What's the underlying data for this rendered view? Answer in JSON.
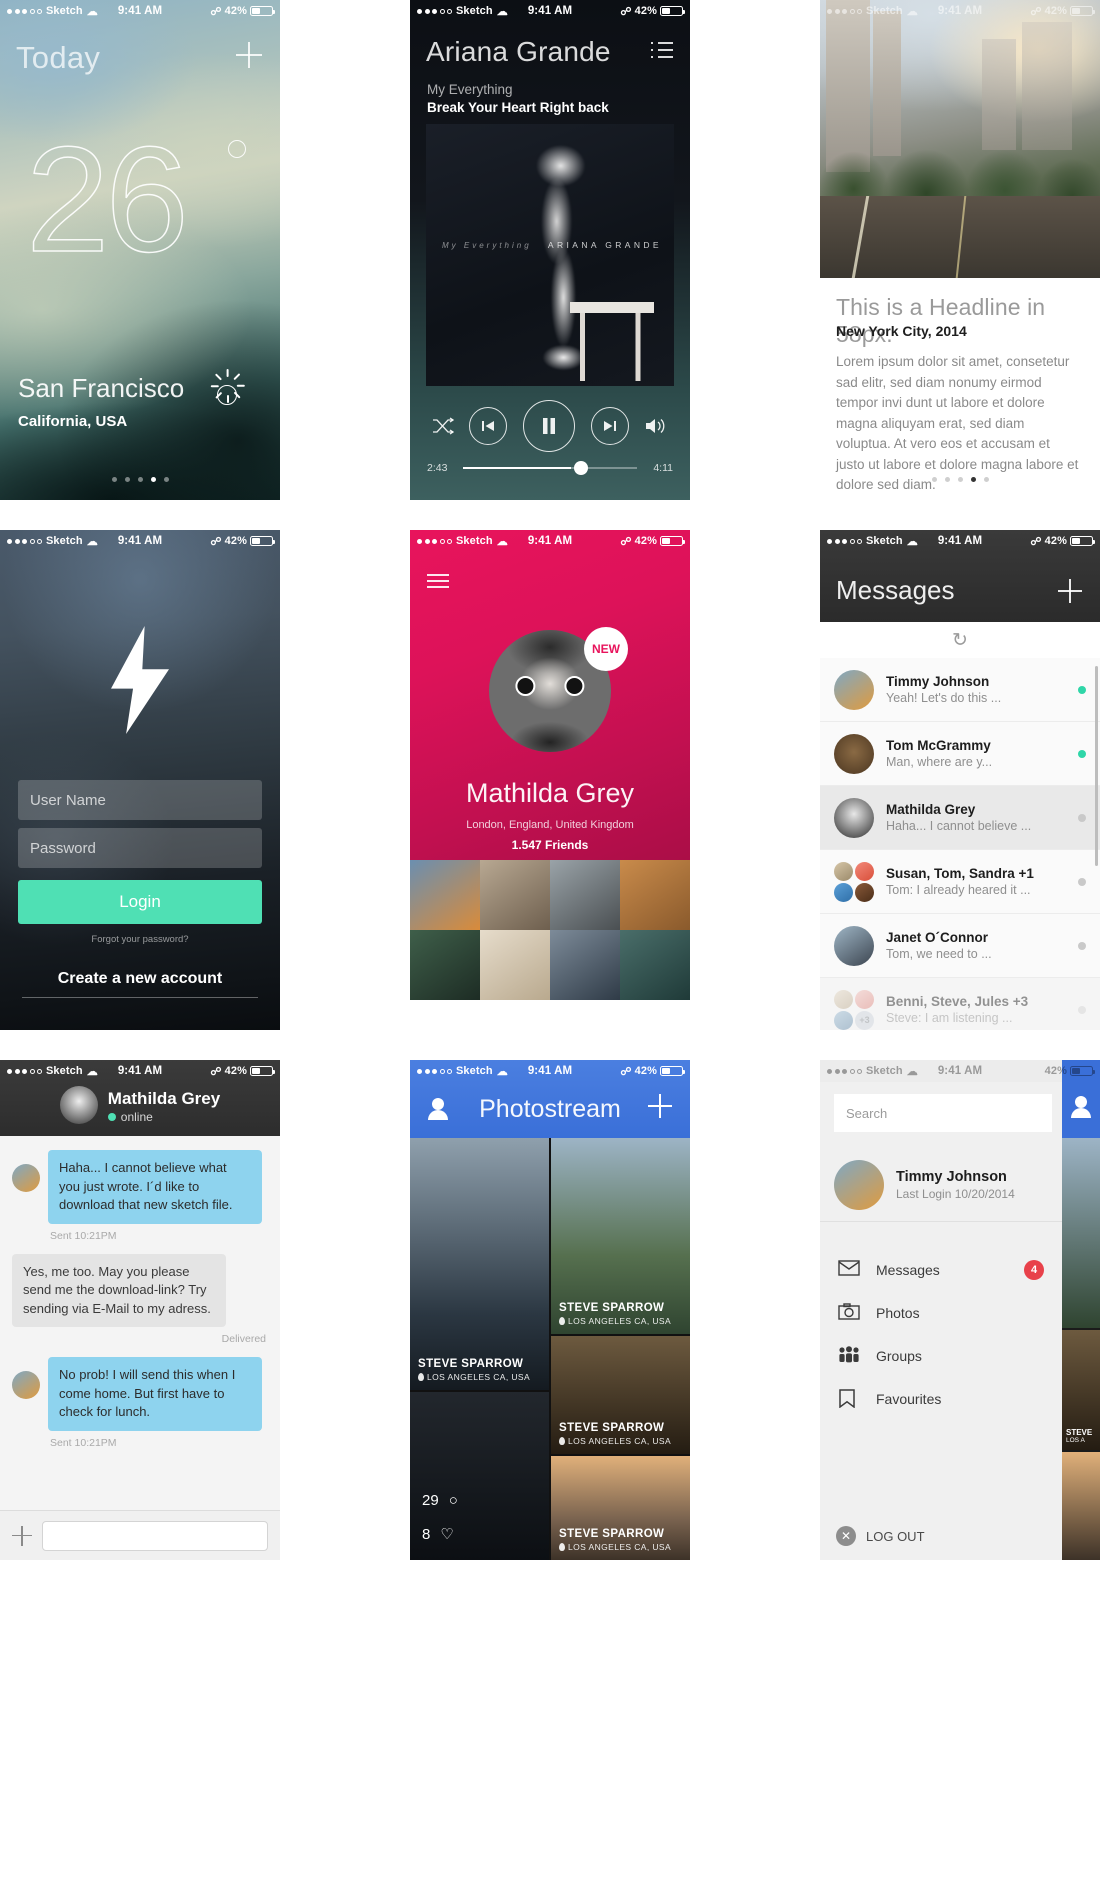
{
  "statusbar": {
    "carrier": "Sketch",
    "time": "9:41 AM",
    "battery": "42%"
  },
  "weather": {
    "title": "Today",
    "temperature": "26",
    "city": "San Francisco",
    "region": "California, USA",
    "add_label": "+",
    "pager": {
      "count": 5,
      "active": 3
    }
  },
  "music": {
    "artist": "Ariana Grande",
    "album": "My Everything",
    "track": "Break Your Heart Right back",
    "cover_left_text": "My Everything",
    "cover_right_text": "ARIANA GRANDE",
    "elapsed": "2:43",
    "remaining": "4:11",
    "progress_percent": 62,
    "controls": [
      "shuffle",
      "previous",
      "pause",
      "next",
      "volume"
    ]
  },
  "article": {
    "headline": "This is a Headline in 58px.",
    "subhead": "New York City, 2014",
    "body": "Lorem ipsum dolor sit amet, consetetur sad elitr, sed diam nonumy eirmod tempor invi dunt ut labore et dolore magna aliquyam erat, sed diam voluptua. At vero eos et accusam et justo ut labore et dolore magna labore et dolore sed diam.",
    "pager": {
      "count": 5,
      "active": 3
    }
  },
  "login": {
    "username_placeholder": "User Name",
    "password_placeholder": "Password",
    "login_label": "Login",
    "forgot_label": "Forgot your password?",
    "create_label": "Create a new account",
    "accent": "#4fe0b4"
  },
  "profile": {
    "name": "Mathilda Grey",
    "location": "London, England, United Kingdom",
    "friends": "1.547 Friends",
    "badge": "NEW",
    "brand": "#e8145c",
    "tiles": [
      {
        "name": "sneakers-photo",
        "c1": "#6b8fb0",
        "c2": "#d98b3a"
      },
      {
        "name": "desert-photo",
        "c1": "#b8a892",
        "c2": "#6e5f4e"
      },
      {
        "name": "road-photo",
        "c1": "#9aa3a8",
        "c2": "#4a4f52"
      },
      {
        "name": "food-bowl-photo",
        "c1": "#c98b4b",
        "c2": "#8a5a2c"
      },
      {
        "name": "leaves-photo",
        "c1": "#3f5f4a",
        "c2": "#1d2c24"
      },
      {
        "name": "jar-flowers-photo",
        "c1": "#e6dccb",
        "c2": "#b9a98e"
      },
      {
        "name": "skyscraper-photo",
        "c1": "#7d8b99",
        "c2": "#2f3b47"
      },
      {
        "name": "coast-photo",
        "c1": "#4a6e6a",
        "c2": "#1f3a38"
      }
    ]
  },
  "messages": {
    "title": "Messages",
    "add_label": "+",
    "refresh_icon": "refresh-icon",
    "rows": [
      {
        "name": "Timmy Johnson",
        "preview": "Yeah! Let's do this ...",
        "unread": true,
        "selected": false,
        "faded": false,
        "avatar": "sneakers-avatar"
      },
      {
        "name": "Tom McGrammy",
        "preview": "Man, where are y...",
        "unread": true,
        "selected": false,
        "faded": false,
        "avatar": "bear-avatar"
      },
      {
        "name": "Mathilda Grey",
        "preview": "Haha... I cannot believe ...",
        "unread": false,
        "selected": true,
        "faded": false,
        "avatar": "mathilda-avatar"
      },
      {
        "name": "Susan, Tom, Sandra +1",
        "preview": "Tom: I already heared it ...",
        "unread": false,
        "selected": false,
        "faded": false,
        "avatar": "group-avatar"
      },
      {
        "name": "Janet O´Connor",
        "preview": "Tom, we need to ...",
        "unread": false,
        "selected": false,
        "faded": false,
        "avatar": "boots-avatar"
      },
      {
        "name": "Benni, Steve, Jules +3",
        "preview": "Steve: I am listening ...",
        "unread": false,
        "selected": false,
        "faded": true,
        "avatar": "group-avatar-plus3"
      }
    ],
    "group_extra": "+3"
  },
  "chat": {
    "contact": "Mathilda Grey",
    "status": "online",
    "bubbles": [
      {
        "side": "in",
        "text": "Haha... I cannot believe what you just wrote. I´d like to download that new sketch file.",
        "meta": "Sent 10:21PM",
        "avatar": "sneakers-avatar"
      },
      {
        "side": "out",
        "text": "Yes, me too. May you please send me the download-link? Try sending via E-Mail to my adress.",
        "meta": "Delivered",
        "avatar": ""
      },
      {
        "side": "in",
        "text": "No prob! I will send this when I come home. But first have to check for lunch.",
        "meta": "Sent 10:21PM",
        "avatar": "sneakers-avatar"
      }
    ],
    "input_placeholder": ""
  },
  "photostream": {
    "title": "Photostream",
    "add_label": "+",
    "photos": [
      {
        "name": "stairs-photo",
        "author": "STEVE SPARROW",
        "place": "LOS ANGELES CA, USA",
        "c1": "#5b6d7a",
        "c2": "#1b2630"
      },
      {
        "name": "counter-stats-photo",
        "likes": "8",
        "comments": "29",
        "c1": "#2a2f35",
        "c2": "#0d1014"
      },
      {
        "name": "mountain-photo",
        "author": "STEVE SPARROW",
        "place": "LOS ANGELES CA, USA",
        "c1": "#8fa3b4",
        "c2": "#3e5a46"
      },
      {
        "name": "spices-photo",
        "author": "STEVE SPARROW",
        "place": "LOS ANGELES CA, USA",
        "c1": "#6d5a3f",
        "c2": "#241c12"
      },
      {
        "name": "city-sunset-photo",
        "author": "STEVE SPARROW",
        "place": "LOS ANGELES CA, USA",
        "c1": "#d8a46a",
        "c2": "#6a5340"
      }
    ]
  },
  "menu": {
    "search_placeholder": "Search",
    "user_name": "Timmy Johnson",
    "last_login": "Last Login 10/20/2014",
    "items": [
      {
        "label": "Messages",
        "icon": "envelope-icon",
        "badge": "4"
      },
      {
        "label": "Photos",
        "icon": "camera-icon",
        "badge": ""
      },
      {
        "label": "Groups",
        "icon": "people-icon",
        "badge": ""
      },
      {
        "label": "Favourites",
        "icon": "bookmark-icon",
        "badge": ""
      }
    ],
    "logout_label": "LOG OUT",
    "badge_color": "#e8414a",
    "peek_caption": "STEVE",
    "peek_place": "LOS A"
  }
}
